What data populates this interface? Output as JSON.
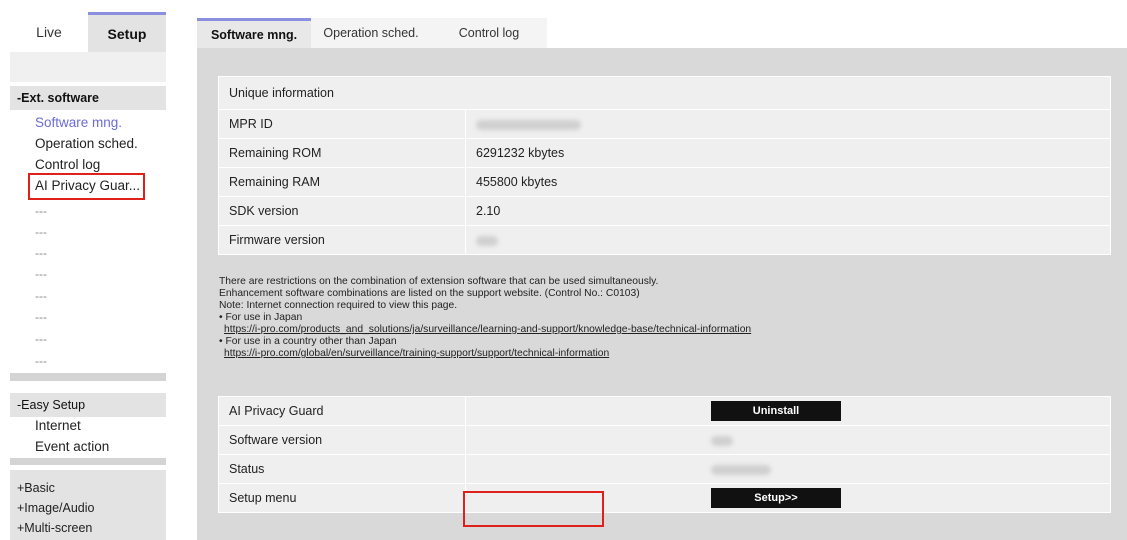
{
  "top_tabs": {
    "live": "Live",
    "setup": "Setup"
  },
  "sidebar": {
    "ext_group": "-Ext. software",
    "ext_items": [
      "Software mng.",
      "Operation sched.",
      "Control log",
      "AI Privacy Guar..."
    ],
    "placeholders": [
      "---",
      "---",
      "---",
      "---",
      "---",
      "---",
      "---",
      "---"
    ],
    "easy_group": "-Easy Setup",
    "easy_items": [
      "Internet",
      "Event action"
    ],
    "basic_groups": [
      "+Basic",
      "+Image/Audio",
      "+Multi-screen"
    ]
  },
  "main_tabs": [
    "Software mng.",
    "Operation sched.",
    "Control log"
  ],
  "unique_info": {
    "header": "Unique information",
    "rows": [
      {
        "label": "MPR ID",
        "value": ""
      },
      {
        "label": "Remaining ROM",
        "value": "6291232 kbytes"
      },
      {
        "label": "Remaining RAM",
        "value": "455800 kbytes"
      },
      {
        "label": "SDK version",
        "value": "2.10"
      },
      {
        "label": "Firmware version",
        "value": ""
      }
    ]
  },
  "notes": {
    "line1": "There are restrictions on the combination of extension software that can be used simultaneously.",
    "line2": "Enhancement software combinations are listed on the support website. (Control No.: C0103)",
    "line3": "Note: Internet connection required to view this page.",
    "japan_label": "• For use in Japan",
    "japan_link": "https://i-pro.com/products_and_solutions/ja/surveillance/learning-and-support/knowledge-base/technical-information",
    "other_label": "• For use in a country other than Japan",
    "other_link": "https://i-pro.com/global/en/surveillance/training-support/support/technical-information"
  },
  "software": {
    "name_label": "AI Privacy Guard",
    "uninstall_label": "Uninstall",
    "version_label": "Software version",
    "status_label": "Status",
    "setup_menu_label": "Setup menu",
    "setup_button": "Setup>>"
  }
}
